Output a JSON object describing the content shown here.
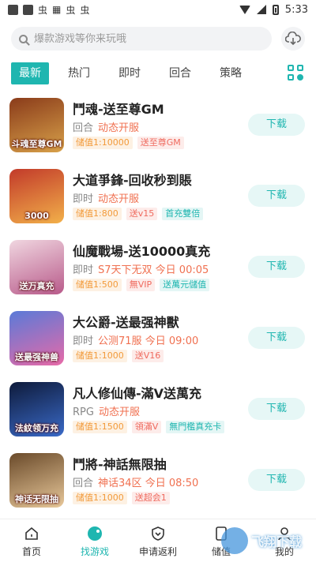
{
  "status_bar": {
    "time": "5:33",
    "left_glyphs": [
      "虫",
      "虫",
      "虫"
    ]
  },
  "search": {
    "placeholder": "爆款游戏等你来玩哦"
  },
  "tabs": [
    {
      "label": "最新",
      "active": true
    },
    {
      "label": "热门",
      "active": false
    },
    {
      "label": "即时",
      "active": false
    },
    {
      "label": "回合",
      "active": false
    },
    {
      "label": "策略",
      "active": false
    }
  ],
  "games": [
    {
      "title": "鬥魂-送至尊GM",
      "type": "回合",
      "status": "动态开服",
      "thumb_caption": "斗魂至尊GM",
      "thumb_colors": [
        "#8a3b1a",
        "#d8a14a"
      ],
      "tags": [
        {
          "text": "储值1:10000",
          "style": "orange"
        },
        {
          "text": "送至尊GM",
          "style": "red"
        }
      ],
      "button": "下载"
    },
    {
      "title": "大道爭鋒-回收秒到賬",
      "type": "即时",
      "status": "动态开服",
      "thumb_caption": "3000",
      "thumb_colors": [
        "#c23a2a",
        "#f2b04a"
      ],
      "tags": [
        {
          "text": "储值1:800",
          "style": "orange"
        },
        {
          "text": "送v15",
          "style": "red"
        },
        {
          "text": "首充雙倍",
          "style": "teal"
        }
      ],
      "button": "下载"
    },
    {
      "title": "仙魔戰場-送10000真充",
      "type": "即时",
      "status": "S7天下无双 今日 00:05",
      "thumb_caption": "送万真充",
      "thumb_colors": [
        "#f0d6e0",
        "#b85a8a"
      ],
      "tags": [
        {
          "text": "储值1:500",
          "style": "orange"
        },
        {
          "text": "無VIP",
          "style": "red"
        },
        {
          "text": "送萬元儲值",
          "style": "teal"
        }
      ],
      "button": "下载"
    },
    {
      "title": "大公爵-送最强神獸",
      "type": "即时",
      "status": "公测71服 今日 09:00",
      "thumb_caption": "送最强神兽",
      "thumb_colors": [
        "#5a7ad8",
        "#e86aa8"
      ],
      "tags": [
        {
          "text": "储值1:1000",
          "style": "orange"
        },
        {
          "text": "送V16",
          "style": "red"
        }
      ],
      "button": "下载"
    },
    {
      "title": "凡人修仙傳-滿V送萬充",
      "type": "RPG",
      "status": "动态开服",
      "thumb_caption": "法紋领万充",
      "thumb_colors": [
        "#0e1a3a",
        "#3a6ac8"
      ],
      "tags": [
        {
          "text": "储值1:1500",
          "style": "orange"
        },
        {
          "text": "領滿V",
          "style": "red"
        },
        {
          "text": "無門檻真充卡",
          "style": "teal"
        }
      ],
      "button": "下载"
    },
    {
      "title": "鬥將-神話無限抽",
      "type": "回合",
      "status": "神话34区 今日 08:50",
      "thumb_caption": "神话无限抽",
      "thumb_colors": [
        "#6a4a2a",
        "#e8c89a"
      ],
      "tags": [
        {
          "text": "储值1:1000",
          "style": "orange"
        },
        {
          "text": "送超会1",
          "style": "red"
        }
      ],
      "button": "下载"
    }
  ],
  "bottom_nav": [
    {
      "label": "首页",
      "icon": "home-icon",
      "active": false
    },
    {
      "label": "找游戏",
      "icon": "gamepad-icon",
      "active": true
    },
    {
      "label": "申请返利",
      "icon": "shield-heart-icon",
      "active": false
    },
    {
      "label": "储值",
      "icon": "wallet-icon",
      "active": false
    },
    {
      "label": "我的",
      "icon": "user-icon",
      "active": false
    }
  ],
  "watermark": "飞翔下载",
  "colors": {
    "accent": "#1fb6b0",
    "status": "#f07050"
  }
}
